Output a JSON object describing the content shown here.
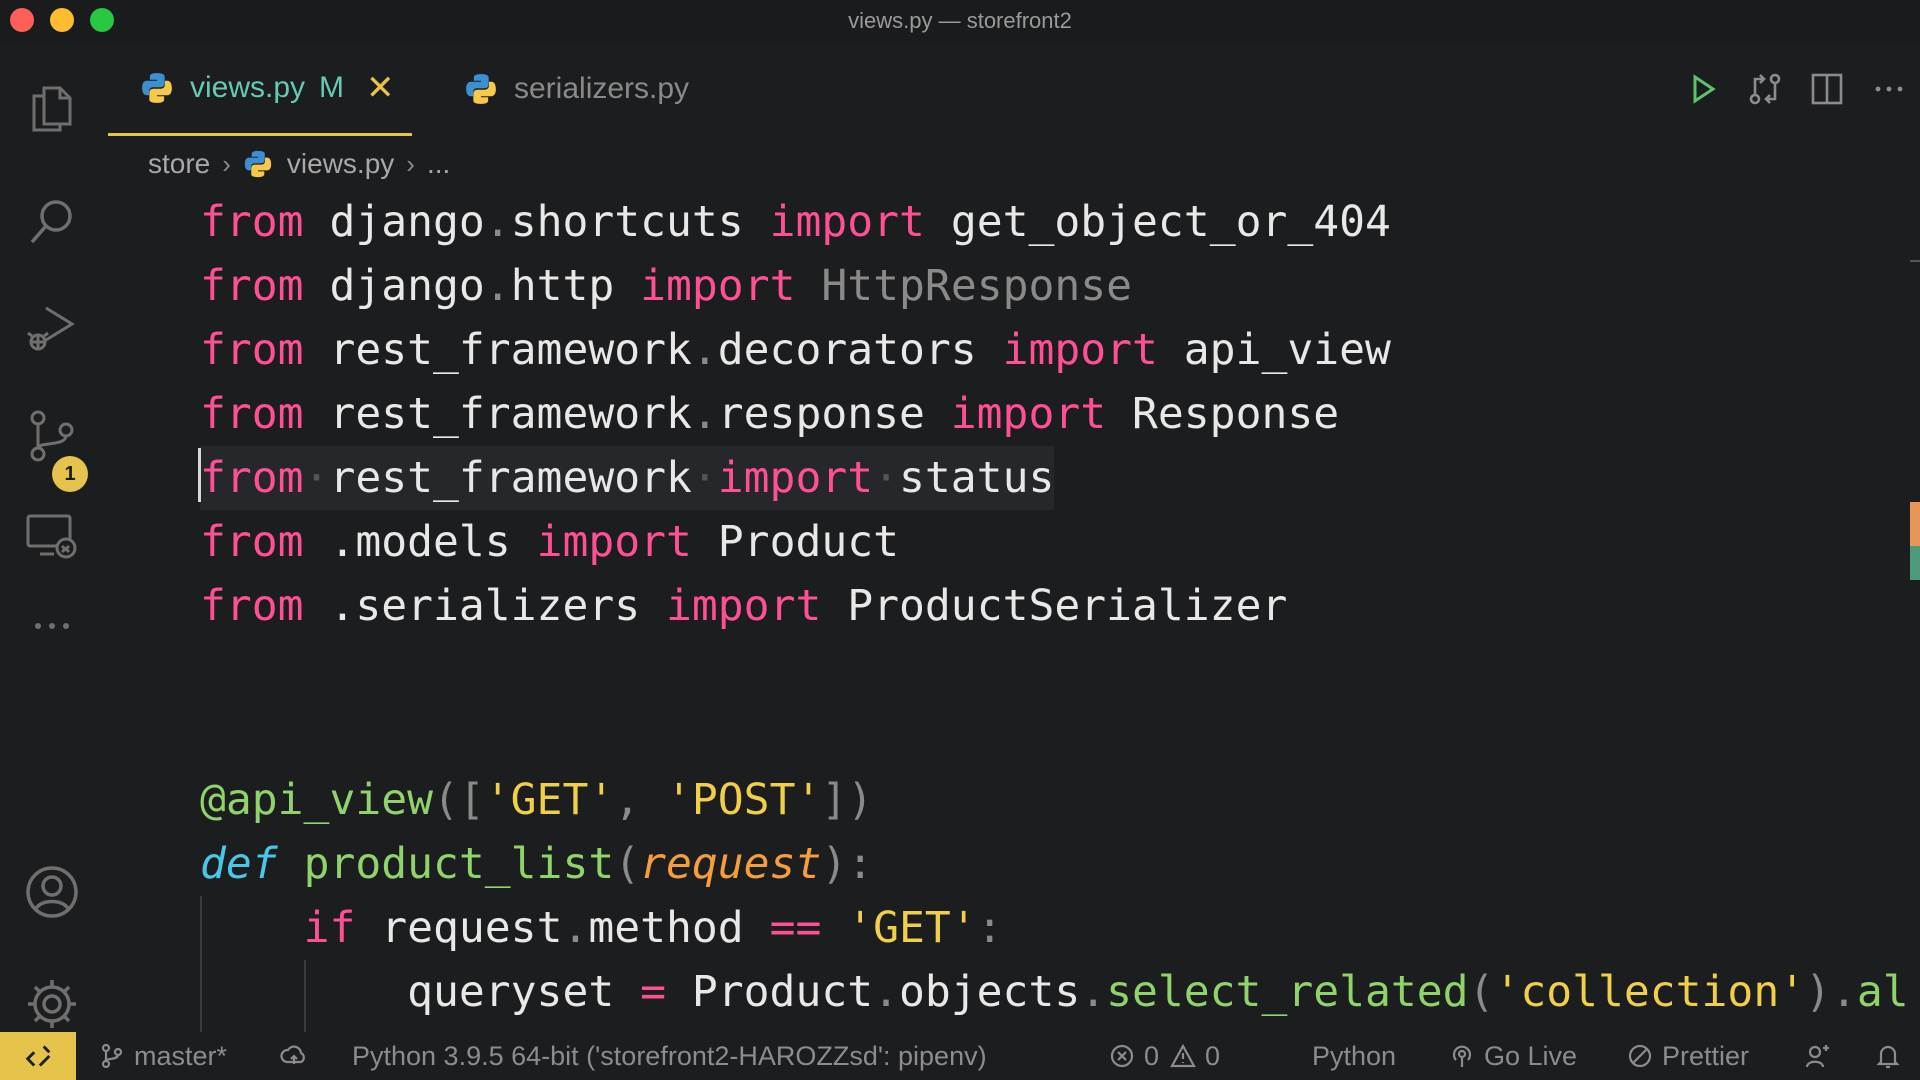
{
  "window": {
    "title": "views.py — storefront2"
  },
  "activity_bar": {
    "scm_badge": "1"
  },
  "tabs": [
    {
      "label": "views.py",
      "status": "M",
      "close": "✕",
      "active": true
    },
    {
      "label": "serializers.py",
      "active": false
    }
  ],
  "breadcrumb": {
    "folder": "store",
    "file": "views.py",
    "more": "..."
  },
  "code": {
    "lines": [
      {
        "kw1": "from",
        "mod": "django",
        "dot": ".",
        "sub": "shortcuts",
        "kw2": "import",
        "name": "get_object_or_404"
      },
      {
        "kw1": "from",
        "mod": "django",
        "dot": ".",
        "sub": "http",
        "kw2": "import",
        "name": "HttpResponse"
      },
      {
        "kw1": "from",
        "mod": "rest_framework",
        "dot": ".",
        "sub": "decorators",
        "kw2": "import",
        "name": "api_view"
      },
      {
        "kw1": "from",
        "mod": "rest_framework",
        "dot": ".",
        "sub": "response",
        "kw2": "import",
        "name": "Response"
      },
      {
        "kw1": "from",
        "mod": "rest_framework",
        "kw2": "import",
        "name": "status"
      },
      {
        "kw1": "from",
        "mod": ".models",
        "kw2": "import",
        "name": "Product"
      },
      {
        "kw1": "from",
        "mod": ".serializers",
        "kw2": "import",
        "name": "ProductSerializer"
      }
    ],
    "decorator": {
      "at": "@",
      "name": "api_view",
      "open": "([",
      "s1": "'GET'",
      "comma": ", ",
      "s2": "'POST'",
      "close": "])"
    },
    "def_line": {
      "kw": "def",
      "name": "product_list",
      "open": "(",
      "param": "request",
      "close": "):"
    },
    "if_line": {
      "kw": "if",
      "obj": "request",
      "dot": ".",
      "attr": "method",
      "op": "==",
      "str": "'GET'",
      "colon": ":"
    },
    "qs_line": {
      "var": "queryset",
      "op": "=",
      "cls": "Product",
      "dot1": ".",
      "attr": "objects",
      "dot2": ".",
      "meth": "select_related",
      "open": "(",
      "str": "'collection'",
      "close": ")",
      "dot3": ".",
      "tail": "al"
    }
  },
  "status_bar": {
    "branch": "master*",
    "interpreter": "Python 3.9.5 64-bit ('storefront2-HAROZZsd': pipenv)",
    "errors": "0",
    "warnings": "0",
    "language": "Python",
    "go_live": "Go Live",
    "prettier": "Prettier"
  }
}
